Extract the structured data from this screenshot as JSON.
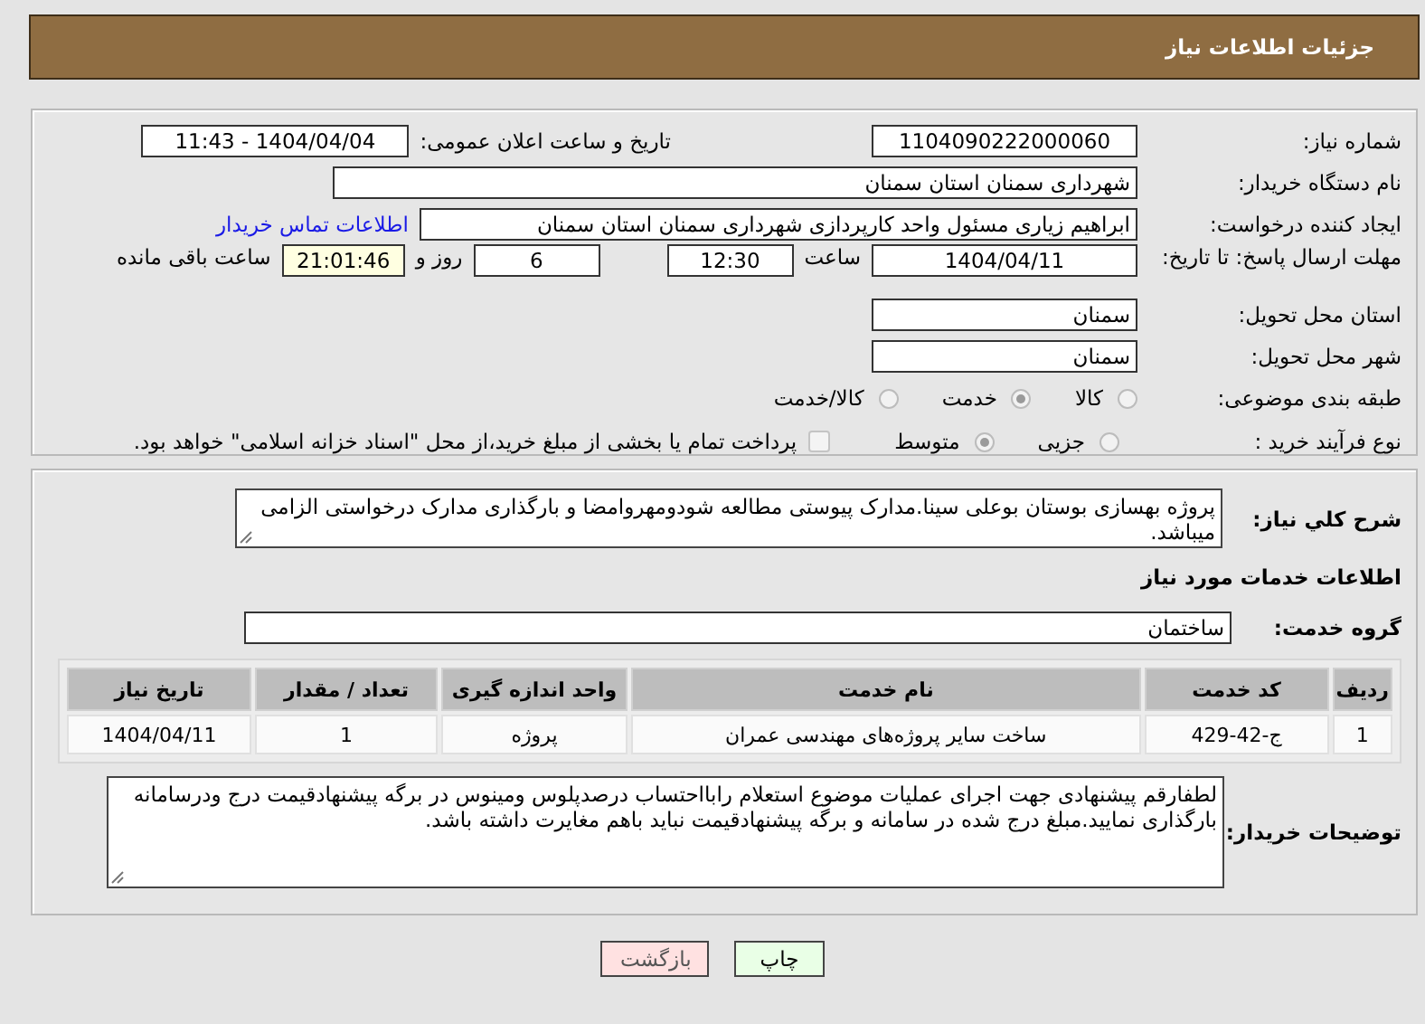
{
  "header": {
    "title": "جزئیات اطلاعات نیاز"
  },
  "need_number": {
    "label": "شماره نیاز:",
    "value": "1104090222000060"
  },
  "announce": {
    "label": "تاریخ و ساعت اعلان عمومی:",
    "value": "1404/04/04 - 11:43"
  },
  "buyer": {
    "label": "نام دستگاه خریدار:",
    "value": "شهرداری سمنان استان سمنان"
  },
  "creator": {
    "label": "ایجاد کننده درخواست:",
    "value": "ابراهیم زیاری مسئول واحد کارپردازی شهرداری سمنان استان سمنان",
    "link": "اطلاعات تماس خریدار"
  },
  "deadline": {
    "label": "مهلت ارسال پاسخ: تا تاریخ:",
    "date": "1404/04/11",
    "time_label": "ساعت",
    "time": "12:30",
    "days": "6",
    "days_label": "روز و",
    "remaining": "21:01:46",
    "remaining_label": "ساعت باقی مانده"
  },
  "province": {
    "label": "استان محل تحویل:",
    "value": "سمنان"
  },
  "city": {
    "label": "شهر محل تحویل:",
    "value": "سمنان"
  },
  "category": {
    "label": "طبقه بندی موضوعی:",
    "options": [
      {
        "label": "کالا",
        "selected": false
      },
      {
        "label": "خدمت",
        "selected": true
      },
      {
        "label": "کالا/خدمت",
        "selected": false
      }
    ]
  },
  "process": {
    "label": "نوع فرآیند خرید :",
    "options": [
      {
        "label": "جزیی",
        "selected": false
      },
      {
        "label": "متوسط",
        "selected": true
      }
    ],
    "payment": {
      "label": "پرداخت تمام یا بخشی از مبلغ خرید،از محل \"اسناد خزانه اسلامی\" خواهد بود.",
      "checked": false
    }
  },
  "description": {
    "label": "شرح کلي نياز:",
    "value": "پروژه بهسازی بوستان بوعلی سینا.مدارک پیوستی مطالعه شودومهروامضا و بارگذاری مدارک درخواستی الزامی میباشد."
  },
  "services_heading": "اطلاعات خدمات مورد نياز",
  "service_group": {
    "label": "گروه خدمت:",
    "value": "ساختمان"
  },
  "table": {
    "columns": [
      "ردیف",
      "کد خدمت",
      "نام خدمت",
      "واحد اندازه گیری",
      "تعداد / مقدار",
      "تاریخ نیاز"
    ],
    "rows": [
      [
        "1",
        "ج-42-429",
        "ساخت سایر پروژه‌های مهندسی عمران",
        "پروژه",
        "1",
        "1404/04/11"
      ]
    ]
  },
  "notes": {
    "label": "توضیحات خریدار:",
    "value": "لطفارقم پیشنهادی جهت اجرای عملیات موضوع استعلام رابااحتساب درصدپلوس ومینوس در برگه پیشنهادقیمت درج ودرسامانه بارگذاری نمایید.مبلغ درج شده در سامانه و برگه پیشنهادقیمت نباید باهم مغایرت داشته باشد."
  },
  "buttons": [
    {
      "kind": "print",
      "label": "چاپ"
    },
    {
      "kind": "back",
      "label": "بازگشت"
    }
  ]
}
